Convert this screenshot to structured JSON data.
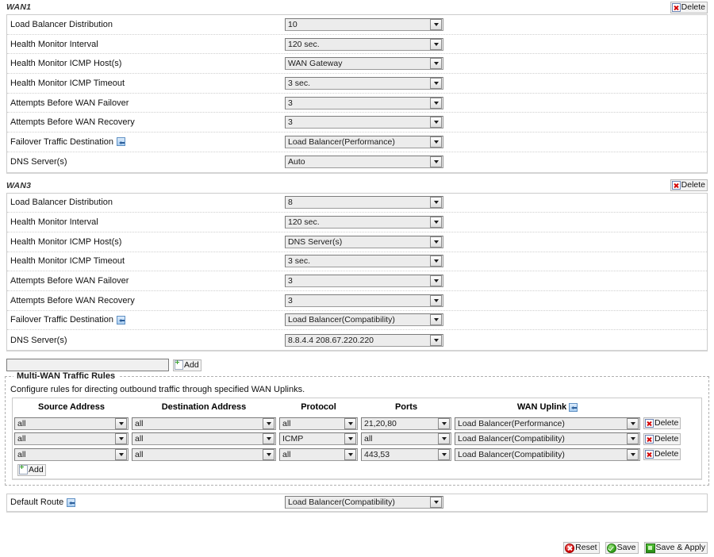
{
  "wan_groups": [
    {
      "title": "WAN1",
      "delete_label": "Delete",
      "rows": [
        {
          "label": "Load Balancer Distribution",
          "value": "10",
          "help": false
        },
        {
          "label": "Health Monitor Interval",
          "value": "120 sec.",
          "help": false
        },
        {
          "label": "Health Monitor ICMP Host(s)",
          "value": "WAN Gateway",
          "help": false
        },
        {
          "label": "Health Monitor ICMP Timeout",
          "value": "3 sec.",
          "help": false
        },
        {
          "label": "Attempts Before WAN Failover",
          "value": "3",
          "help": false
        },
        {
          "label": "Attempts Before WAN Recovery",
          "value": "3",
          "help": false
        },
        {
          "label": "Failover Traffic Destination",
          "value": "Load Balancer(Performance)",
          "help": true
        },
        {
          "label": "DNS Server(s)",
          "value": "Auto",
          "help": false
        }
      ]
    },
    {
      "title": "WAN3",
      "delete_label": "Delete",
      "rows": [
        {
          "label": "Load Balancer Distribution",
          "value": "8",
          "help": false
        },
        {
          "label": "Health Monitor Interval",
          "value": "120 sec.",
          "help": false
        },
        {
          "label": "Health Monitor ICMP Host(s)",
          "value": "DNS Server(s)",
          "help": false
        },
        {
          "label": "Health Monitor ICMP Timeout",
          "value": "3 sec.",
          "help": false
        },
        {
          "label": "Attempts Before WAN Failover",
          "value": "3",
          "help": false
        },
        {
          "label": "Attempts Before WAN Recovery",
          "value": "3",
          "help": false
        },
        {
          "label": "Failover Traffic Destination",
          "value": "Load Balancer(Compatibility)",
          "help": true
        },
        {
          "label": "DNS Server(s)",
          "value": "8.8.4.4 208.67.220.220",
          "help": false
        }
      ]
    }
  ],
  "add_wan": {
    "input_value": "",
    "input_placeholder": "",
    "add_label": "Add"
  },
  "traffic_rules": {
    "legend": "Multi-WAN Traffic Rules",
    "description": "Configure rules for directing outbound traffic through specified WAN Uplinks.",
    "columns": {
      "source": "Source Address",
      "destination": "Destination Address",
      "protocol": "Protocol",
      "ports": "Ports",
      "uplink": "WAN Uplink"
    },
    "rows": [
      {
        "source": "all",
        "destination": "all",
        "protocol": "all",
        "ports": "21,20,80",
        "uplink": "Load Balancer(Performance)",
        "delete_label": "Delete"
      },
      {
        "source": "all",
        "destination": "all",
        "protocol": "ICMP",
        "ports": "all",
        "uplink": "Load Balancer(Compatibility)",
        "delete_label": "Delete"
      },
      {
        "source": "all",
        "destination": "all",
        "protocol": "all",
        "ports": "443,53",
        "uplink": "Load Balancer(Compatibility)",
        "delete_label": "Delete"
      }
    ],
    "add_label": "Add"
  },
  "default_route": {
    "label": "Default Route",
    "value": "Load Balancer(Compatibility)"
  },
  "footer": {
    "reset_label": "Reset",
    "save_label": "Save",
    "apply_label": "Save & Apply"
  },
  "colors": {
    "delete_red": "#d40000",
    "add_green": "#35a02a",
    "help_blue": "#5f90c4"
  }
}
